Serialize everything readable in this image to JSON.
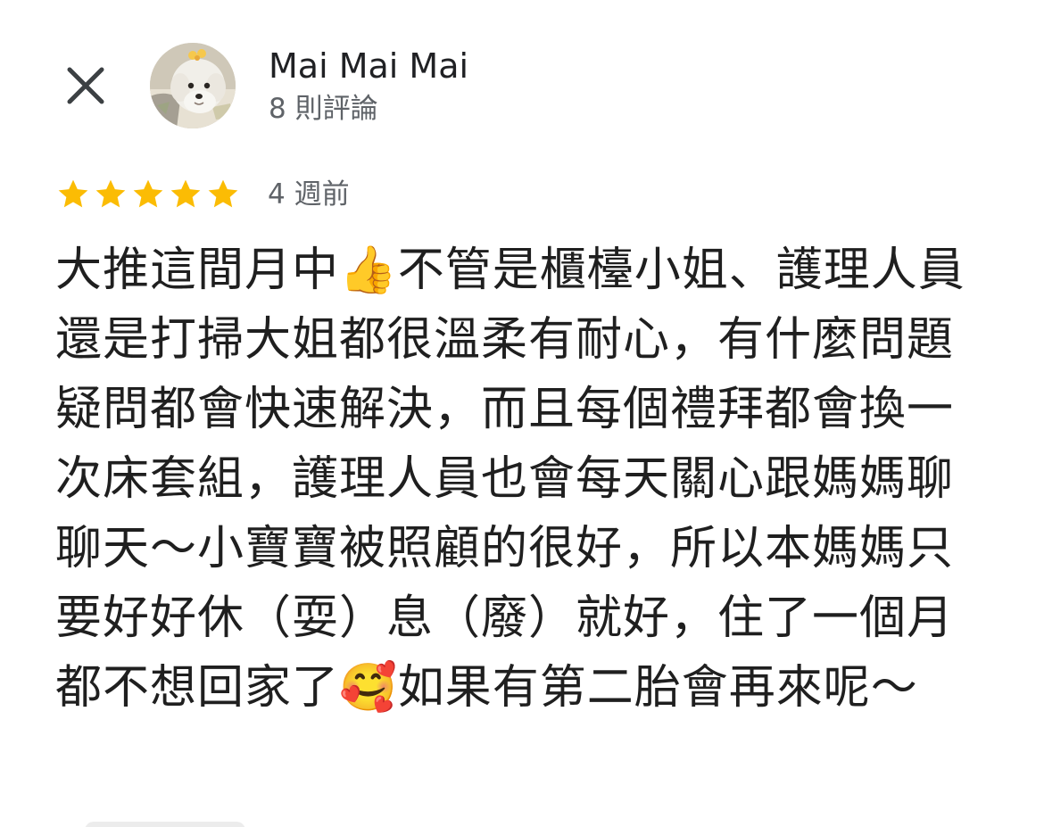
{
  "review": {
    "reviewer_name": "Mai Mai Mai",
    "review_count": "8 則評論",
    "rating": 5,
    "rating_max": 5,
    "date": "4 週前",
    "text": "大推這間月中👍不管是櫃檯小姐、護理人員還是打掃大姐都很溫柔有耐心，有什麼問題疑問都會快速解決，而且每個禮拜都會換一次床套組，護理人員也會每天關心跟媽媽聊聊天～小寶寶被照顧的很好，所以本媽媽只要好好休（耍）息（廢）就好，住了一個月都不想回家了🥰如果有第二胎會再來呢～"
  },
  "icons": {
    "close": "close-icon",
    "star": "star-icon",
    "avatar": "dog-avatar-photo"
  },
  "colors": {
    "star": "#FBBC04",
    "name": "#202124",
    "secondary_text": "#5F6368",
    "body_text": "#1F1F1F"
  }
}
